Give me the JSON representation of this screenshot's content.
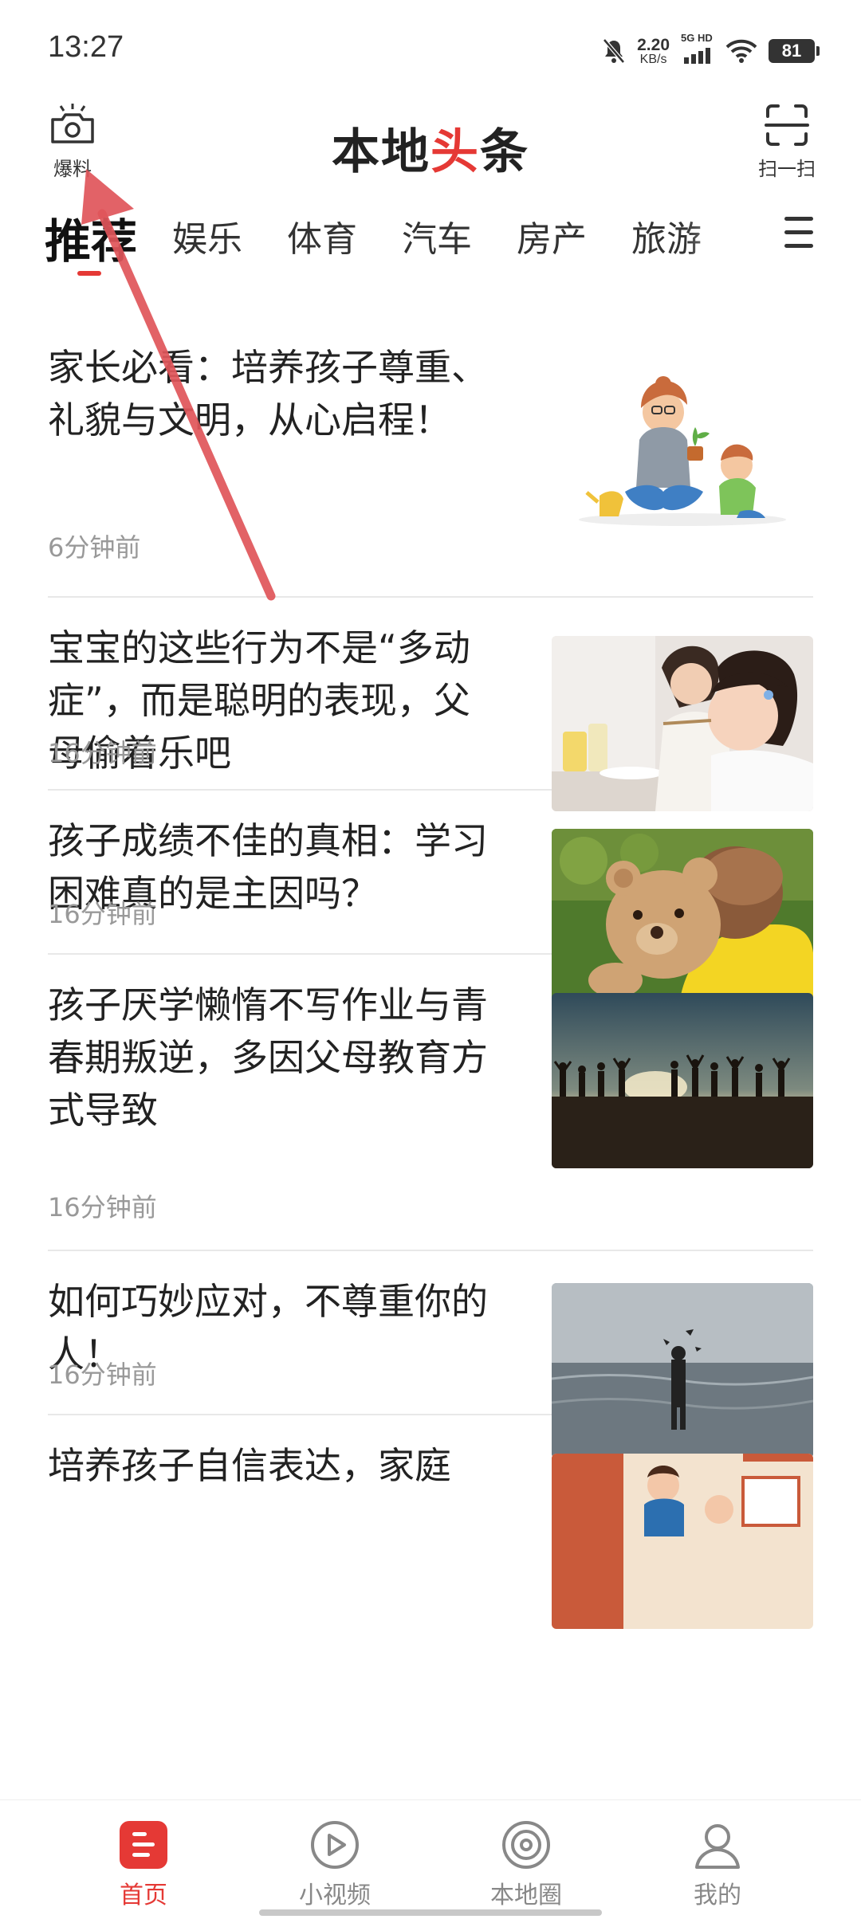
{
  "status_bar": {
    "time": "13:27",
    "net_speed_value": "2.20",
    "net_speed_unit": "KB/s",
    "signal_label": "5G HD",
    "battery": "81",
    "icons": [
      "bell-off-icon",
      "signal-icon",
      "wifi-icon",
      "battery-icon"
    ]
  },
  "header": {
    "baoliao_label": "爆料",
    "logo_black": "本地",
    "logo_red": "头",
    "logo_black2": "条",
    "scan_label": "扫一扫"
  },
  "tabs": [
    "推荐",
    "娱乐",
    "体育",
    "汽车",
    "房产",
    "旅游"
  ],
  "active_tab": "推荐",
  "articles": [
    {
      "title": "家长必看：培养孩子尊重、礼貌与文明，从心启程！",
      "time": "6分钟前",
      "thumb": "parent-child-illustration"
    },
    {
      "title": "宝宝的这些行为不是“多动症”，而是聪明的表现，父母偷着乐吧",
      "time": "16分钟前",
      "thumb": "child-eating-photo"
    },
    {
      "title": "孩子成绩不佳的真相：学习困难真的是主因吗？",
      "time": "16分钟前",
      "thumb": "child-teddy-bear-photo"
    },
    {
      "title": "孩子厌学懒惰不写作业与青春期叛逆，多因父母教育方式导致",
      "time": "16分钟前",
      "thumb": "silhouettes-sunset-photo"
    },
    {
      "title": "如何巧妙应对，不尊重你的人！",
      "time": "16分钟前",
      "thumb": "man-in-sea-photo"
    },
    {
      "title": "培养孩子自信表达，家庭",
      "time": "",
      "thumb": "classroom-illustration"
    }
  ],
  "bottom_nav": [
    {
      "label": "首页",
      "icon": "home-icon",
      "active": true
    },
    {
      "label": "小视频",
      "icon": "play-icon",
      "active": false
    },
    {
      "label": "本地圈",
      "icon": "target-icon",
      "active": false
    },
    {
      "label": "我的",
      "icon": "user-icon",
      "active": false
    }
  ],
  "colors": {
    "accent": "#e53935",
    "text": "#222222",
    "muted": "#999999"
  }
}
